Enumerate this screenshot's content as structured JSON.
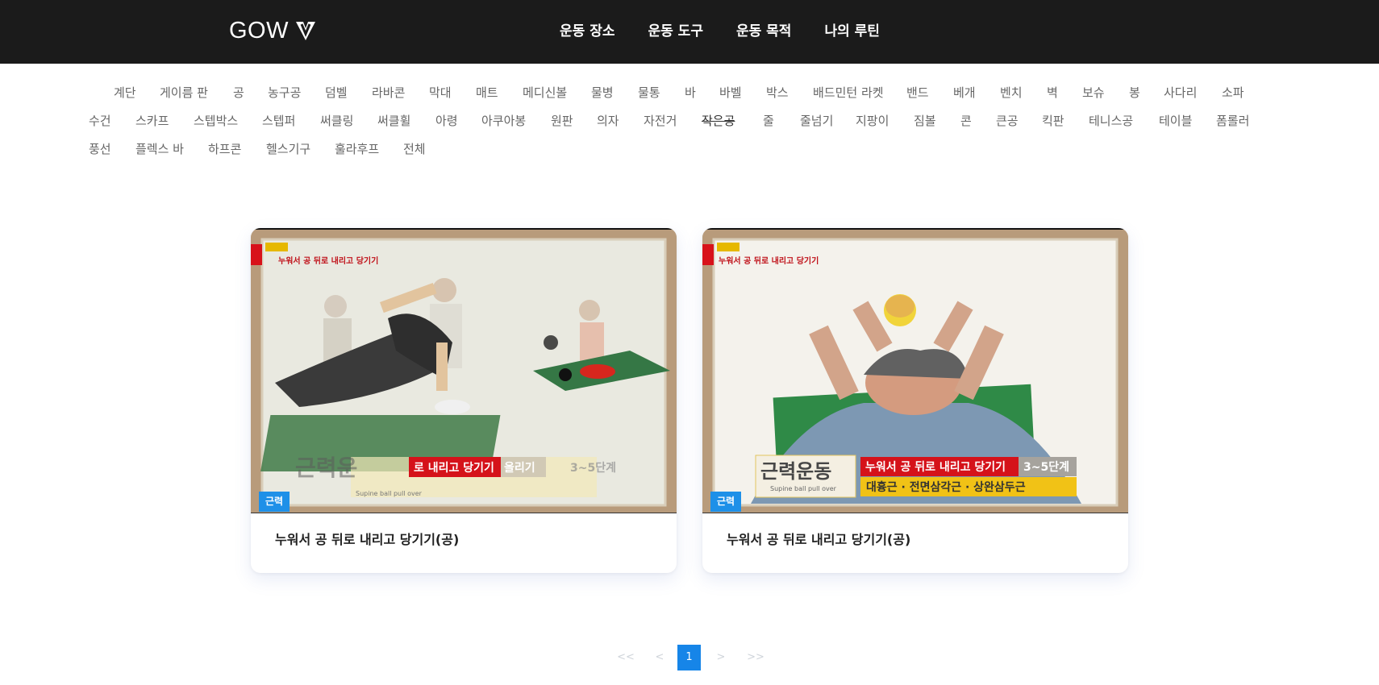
{
  "header": {
    "logo_text": "GOW",
    "nav": [
      "운동 장소",
      "운동 도구",
      "운동 목적",
      "나의 루틴"
    ]
  },
  "categories": {
    "row1": [
      "계단",
      "게이름 판",
      "공",
      "농구공",
      "덤벨",
      "라바콘",
      "막대",
      "매트",
      "메디신볼",
      "물병",
      "물통",
      "바",
      "바벨",
      "박스",
      "배드민턴 라켓",
      "밴드",
      "베개",
      "벤치",
      "벽",
      "보슈",
      "봉",
      "사다리",
      "소파"
    ],
    "row2": [
      "수건",
      "스카프",
      "스텝박스",
      "스텝퍼",
      "써클링",
      "써클휠",
      "아령",
      "아쿠아봉",
      "원판",
      "의자",
      "자전거",
      "작은공",
      "줄",
      "줄넘기",
      "지팡이",
      "짐볼",
      "콘",
      "큰공",
      "킥판",
      "테니스공",
      "테이블",
      "폼롤러"
    ],
    "row3": [
      "풍선",
      "플렉스 바",
      "하프콘",
      "헬스기구",
      "훌라후프",
      "전체"
    ]
  },
  "cards": [
    {
      "badge": "근력",
      "title": "누워서 공 뒤로 내리고 당기기(공)",
      "overlay_top": "누워서 공 뒤로 내리고 당기기",
      "overlay_tag": "근력운동",
      "overlay_sub": "Supine ball pull over",
      "caption_red": "로 내리고 당기기",
      "caption_gray": "올리기",
      "step": "3~5단계",
      "caption_left": "근력운"
    },
    {
      "badge": "근력",
      "title": "누워서 공 뒤로 내리고 당기기(공)",
      "overlay_top": "누워서 공 뒤로 내리고 당기기",
      "overlay_tag": "근력운동",
      "overlay_sub": "Supine ball pull over",
      "caption_big": "근력운동",
      "caption_red": "누워서 공 뒤로 내리고 당기기",
      "step": "3~5단계",
      "caption_yellow": "대흉근 · 전면삼각근 · 상완삼두근"
    }
  ],
  "pagination": {
    "first": "<<",
    "prev": "<",
    "current": "1",
    "next": ">",
    "last": ">>"
  },
  "colors": {
    "header_bg": "#1b1b1b",
    "badge": "#1e90e8",
    "page_active": "#1685e8"
  }
}
